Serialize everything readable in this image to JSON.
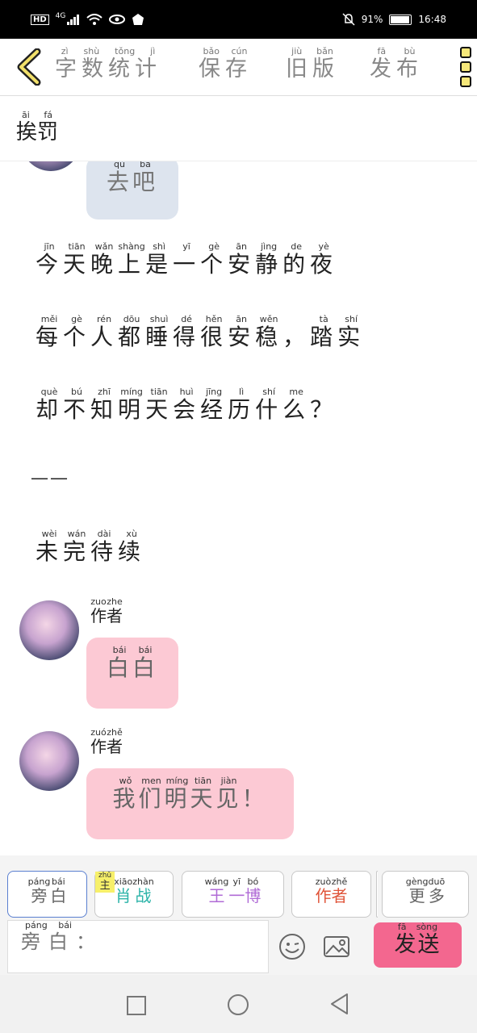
{
  "status_bar": {
    "hd": "HD",
    "network": "4G",
    "battery_text": "91%",
    "time": "16:48"
  },
  "toolbar": {
    "word_count": "字数统计",
    "word_count_py": [
      "zì",
      "shù",
      "tǒng",
      "jì"
    ],
    "save": "保存",
    "save_py": [
      "bǎo",
      "cún"
    ],
    "old_version": "旧版",
    "old_version_py": [
      "jiù",
      "bǎn"
    ],
    "publish": "发布",
    "publish_py": [
      "fā",
      "bù"
    ]
  },
  "story_title": {
    "text": "挨罚",
    "py": [
      "āi",
      "fá"
    ]
  },
  "messages": [
    {
      "type": "bubble",
      "role": "prev",
      "text": "去吧",
      "py": [
        "qù",
        "ba"
      ]
    },
    {
      "type": "narration",
      "text": "今天晚上是一个安静的夜",
      "py": [
        "jīn",
        "tiān",
        "wǎn",
        "shàng",
        "shì",
        "yī",
        "gè",
        "ān",
        "jìng",
        "de",
        "yè"
      ]
    },
    {
      "type": "narration",
      "text": "每个人都睡得很安稳，踏实",
      "py": [
        "měi",
        "gè",
        "rén",
        "dōu",
        "shuì",
        "dé",
        "hěn",
        "ān",
        "wěn",
        "",
        "tà",
        "shí"
      ]
    },
    {
      "type": "narration",
      "text": "却不知明天会经历什么？",
      "py": [
        "què",
        "bú",
        "zhī",
        "míng",
        "tiān",
        "huì",
        "jīng",
        "lì",
        "shí",
        "me",
        ""
      ]
    },
    {
      "type": "narration",
      "text": "——",
      "py": []
    },
    {
      "type": "narration",
      "text": "未完待续",
      "py": [
        "wèi",
        "wán",
        "dài",
        "xù"
      ]
    },
    {
      "type": "bubble",
      "author": "作者",
      "author_py": [
        "zuo",
        "zhe"
      ],
      "text": "白白",
      "py": [
        "bái",
        "bái"
      ]
    },
    {
      "type": "bubble",
      "author": "作者",
      "author_py": [
        "zuó",
        "zhě"
      ],
      "text": "我们明天见！",
      "py": [
        "wǒ",
        "men",
        "míng",
        "tiān",
        "jiàn",
        ""
      ]
    }
  ],
  "roles": [
    {
      "label": "旁白",
      "py": [
        "páng",
        "bái"
      ],
      "color": "#666666",
      "selected": true
    },
    {
      "label": "肖战",
      "py": [
        "xiāo",
        "zhàn"
      ],
      "color": "#2bb3a8",
      "badge": "主",
      "badge_py": "zhǔ"
    },
    {
      "label": "王一博",
      "py": [
        "wáng",
        "yī",
        "bó"
      ],
      "color": "#b06bd6"
    },
    {
      "label": "作者",
      "py": [
        "zuò",
        "zhě"
      ],
      "color": "#e0553a"
    },
    {
      "label": "更多",
      "py": [
        "gèng",
        "duō"
      ],
      "color": "#666666"
    }
  ],
  "input": {
    "prefix": "旁白",
    "prefix_py": [
      "páng",
      "bái"
    ],
    "colon": "："
  },
  "send": {
    "text": "发送",
    "py": [
      "fā",
      "sòng"
    ]
  },
  "colors": {
    "send_bg": "#f3678f",
    "pink_bubble": "#fcc9d4",
    "blue_bubble": "#dde4ee",
    "back_accent": "#f2e06a"
  }
}
